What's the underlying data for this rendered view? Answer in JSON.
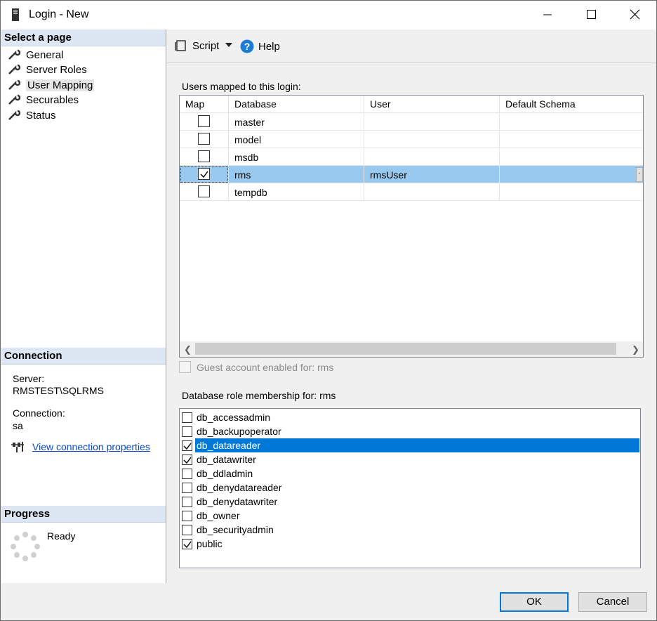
{
  "window": {
    "title": "Login - New"
  },
  "left": {
    "select_page_header": "Select a page",
    "pages": [
      {
        "label": "General"
      },
      {
        "label": "Server Roles"
      },
      {
        "label": "User Mapping"
      },
      {
        "label": "Securables"
      },
      {
        "label": "Status"
      }
    ],
    "connection_header": "Connection",
    "server_label": "Server:",
    "server_value": "RMSTEST\\SQLRMS",
    "connection_label": "Connection:",
    "connection_value": "sa",
    "view_props_link": "View connection properties",
    "progress_header": "Progress",
    "progress_status": "Ready"
  },
  "toolbar": {
    "script_label": "Script",
    "help_label": "Help"
  },
  "mapping": {
    "group_label": "Users mapped to this login:",
    "columns": [
      "Map",
      "Database",
      "User",
      "Default Schema"
    ],
    "rows": [
      {
        "checked": false,
        "database": "master",
        "user": "",
        "schema": ""
      },
      {
        "checked": false,
        "database": "model",
        "user": "",
        "schema": ""
      },
      {
        "checked": false,
        "database": "msdb",
        "user": "",
        "schema": ""
      },
      {
        "checked": true,
        "database": "rms",
        "user": "rmsUser",
        "schema": ""
      },
      {
        "checked": false,
        "database": "tempdb",
        "user": "",
        "schema": ""
      }
    ],
    "ellipsis": ".",
    "guest_label": "Guest account enabled for: rms"
  },
  "roles": {
    "group_label": "Database role membership for: rms",
    "items": [
      {
        "label": "db_accessadmin",
        "checked": false
      },
      {
        "label": "db_backupoperator",
        "checked": false
      },
      {
        "label": "db_datareader",
        "checked": true
      },
      {
        "label": "db_datawriter",
        "checked": true
      },
      {
        "label": "db_ddladmin",
        "checked": false
      },
      {
        "label": "db_denydatareader",
        "checked": false
      },
      {
        "label": "db_denydatawriter",
        "checked": false
      },
      {
        "label": "db_owner",
        "checked": false
      },
      {
        "label": "db_securityadmin",
        "checked": false
      },
      {
        "label": "public",
        "checked": true
      }
    ]
  },
  "buttons": {
    "ok": "OK",
    "cancel": "Cancel"
  },
  "colors": {
    "selected_row": "#99c9ef",
    "selected_role": "#0078d7",
    "section_header": "#dde7f3",
    "link": "#0a47c9"
  }
}
